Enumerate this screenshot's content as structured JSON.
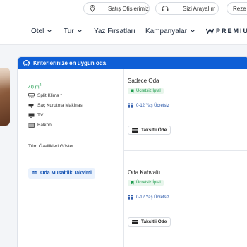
{
  "topbar": {
    "sales_offices": "Satış Ofislerimiz",
    "call_you": "Sizi Arayalım",
    "reservation_partial": "Reze"
  },
  "nav": {
    "items": [
      {
        "label": "Otel",
        "has_dropdown": true
      },
      {
        "label": "Tur",
        "has_dropdown": true
      },
      {
        "label": "Yaz Fırsatları",
        "has_dropdown": false
      },
      {
        "label": "Kampanyalar",
        "has_dropdown": true
      }
    ],
    "premium": "PREMIU"
  },
  "card": {
    "header": "Kriterlerinize en uygun oda",
    "area": "40 m",
    "area_unit_sup": "2",
    "features": [
      {
        "icon": "air-conditioner-icon",
        "label": "Split Klima *"
      },
      {
        "icon": "hair-dryer-icon",
        "label": "Saç Kurutma Makinası"
      },
      {
        "icon": "tv-icon",
        "label": "TV"
      },
      {
        "icon": "balcony-icon",
        "label": "Balkon"
      }
    ],
    "show_all": "Tüm Özellikleri Göster",
    "calendar_button": "Oda Müsaitlik Takvimi"
  },
  "rooms": [
    {
      "title": "Sadece Oda",
      "free_cancel": "Ücretsiz İptal",
      "child_info": "0-12 Yaş Ücretsiz",
      "installment": "Taksitli Öde"
    },
    {
      "title": "Oda Kahvaltı",
      "free_cancel": "Ücretsiz İptal",
      "child_info": "0-12 Yaş Ücretsiz",
      "installment": "Taksitli Öde"
    }
  ],
  "colors": {
    "primary": "#0f5fd6",
    "success": "#1c9a4c",
    "nav_text": "#1f2b3d"
  }
}
